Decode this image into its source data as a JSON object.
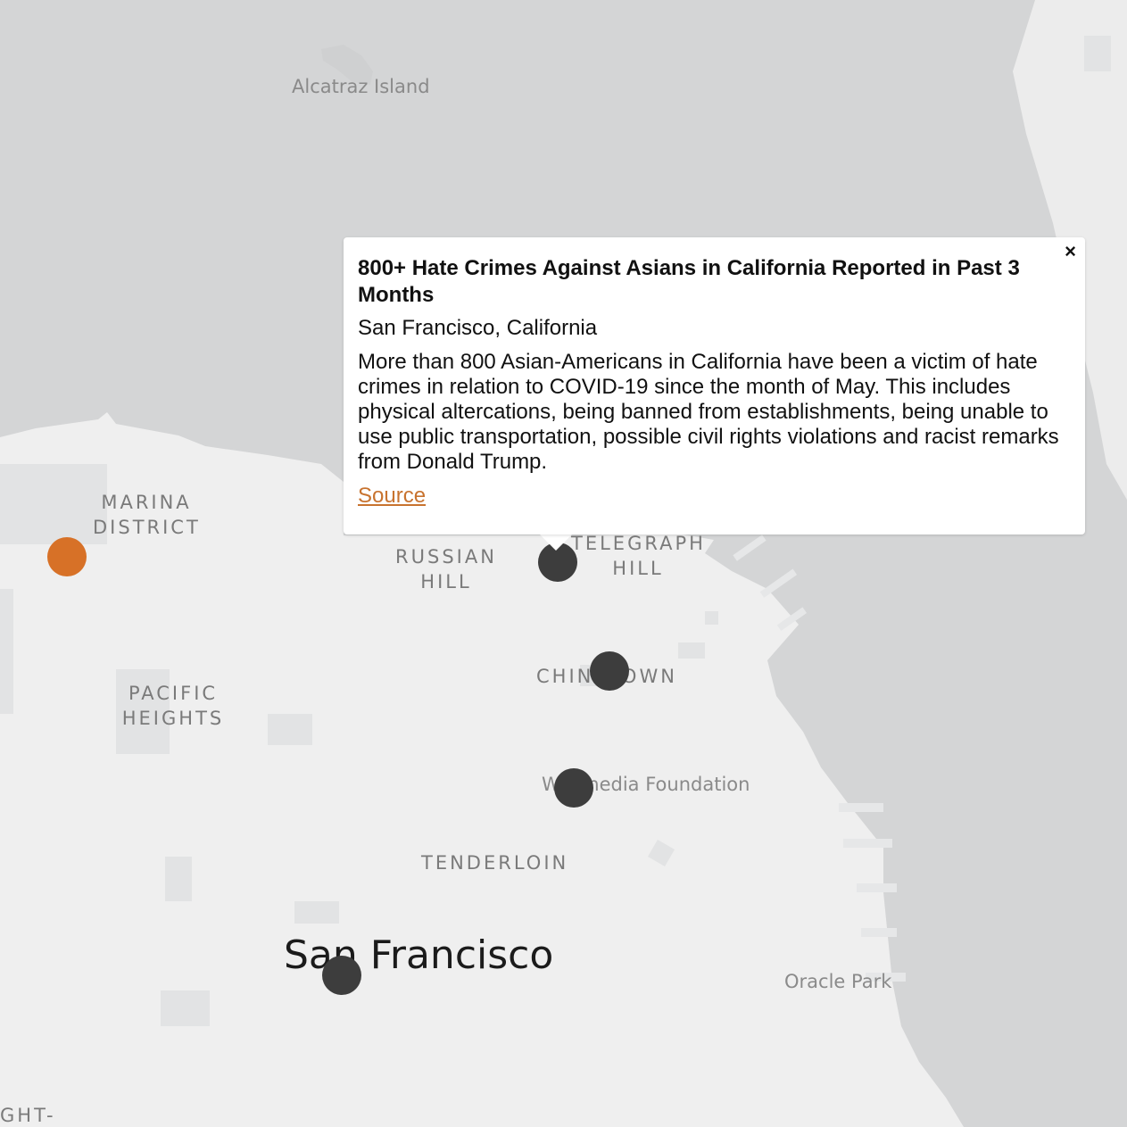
{
  "map": {
    "labels": {
      "alcatraz": "Alcatraz Island",
      "marina": "MARINA\nDISTRICT",
      "russian_hill": "RUSSIAN\nHILL",
      "telegraph_hill": "TELEGRAPH\nHILL",
      "chinatown": "CHINATOWN",
      "pacific_heights": "PACIFIC\nHEIGHTS",
      "wikimedia": "Wikimedia Foundation",
      "tenderloin": "TENDERLOIN",
      "city": "San Francisco",
      "oracle_park": "Oracle Park",
      "haight_fragment": "GHT-"
    },
    "colors": {
      "water": "#d4d5d6",
      "land": "#efefef",
      "building": "#e2e3e4",
      "marker_default": "#3d3d3d",
      "marker_highlight": "#d77127",
      "link": "#c8732f"
    },
    "markers": [
      {
        "id": "marina",
        "color": "orange"
      },
      {
        "id": "telegraph-hill",
        "color": "dark"
      },
      {
        "id": "chinatown",
        "color": "dark"
      },
      {
        "id": "wikimedia",
        "color": "dark"
      },
      {
        "id": "san-francisco",
        "color": "dark"
      }
    ]
  },
  "popup": {
    "close": "×",
    "title": "800+ Hate Crimes Against Asians in California Reported in Past 3 Months",
    "location": "San Francisco, California",
    "body": "More than 800 Asian-Americans in California have been a victim of hate crimes in relation to COVID-19 since the month of May. This includes physical altercations, being banned from establishments, being unable to use public transportation, possible civil rights violations and racist remarks from Donald Trump.",
    "link_text": "Source"
  }
}
